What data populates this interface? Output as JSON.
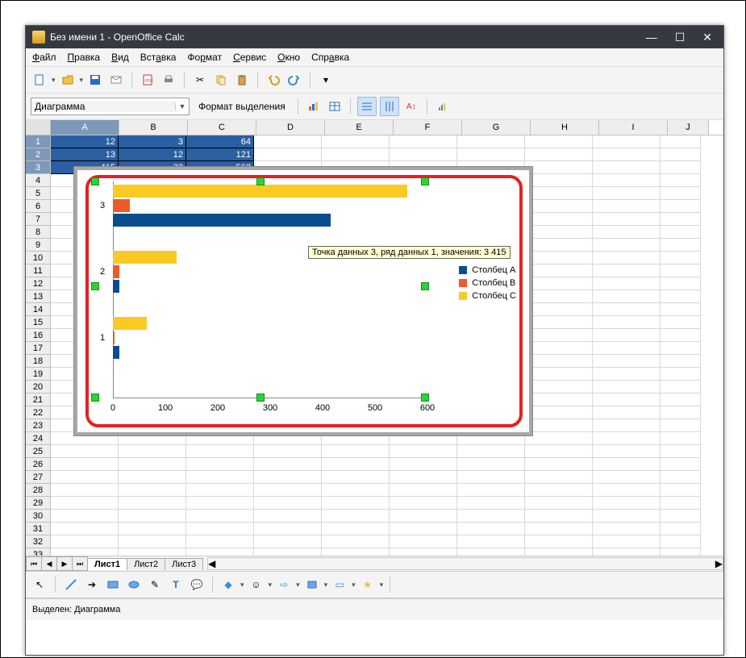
{
  "window": {
    "title": "Без имени 1 - OpenOffice Calc"
  },
  "menu": {
    "file": "Файл",
    "edit": "Правка",
    "view": "Вид",
    "insert": "Вставка",
    "format": "Формат",
    "tools": "Сервис",
    "window": "Окно",
    "help": "Справка"
  },
  "selection_box": {
    "value": "Диаграмма",
    "format_label": "Формат выделения"
  },
  "columns": [
    "A",
    "B",
    "C",
    "D",
    "E",
    "F",
    "G",
    "H",
    "I",
    "J"
  ],
  "row_count": 33,
  "data_cells": {
    "r1": {
      "A": "12",
      "B": "3",
      "C": "64"
    },
    "r2": {
      "A": "13",
      "B": "12",
      "C": "121"
    },
    "r3": {
      "A": "415",
      "B": "32",
      "C": "562"
    }
  },
  "legend": {
    "a": "Столбец A",
    "b": "Столбец B",
    "c": "Столбец C"
  },
  "x_ticks": [
    "0",
    "100",
    "200",
    "300",
    "400",
    "500",
    "600"
  ],
  "y_cats": [
    "1",
    "2",
    "3"
  ],
  "tooltip": "Точка данных 3, ряд данных 1, значения: 3 415",
  "tabs": {
    "t1": "Лист1",
    "t2": "Лист2",
    "t3": "Лист3"
  },
  "status": "Выделен: Диаграмма",
  "chart_data": {
    "type": "bar",
    "orientation": "horizontal",
    "categories": [
      "1",
      "2",
      "3"
    ],
    "series": [
      {
        "name": "Столбец A",
        "values": [
          12,
          13,
          415
        ],
        "color": "#0a4d8c"
      },
      {
        "name": "Столбец B",
        "values": [
          3,
          12,
          32
        ],
        "color": "#ef5a28"
      },
      {
        "name": "Столбец C",
        "values": [
          64,
          121,
          562
        ],
        "color": "#f9ca24"
      }
    ],
    "xlim": [
      0,
      600
    ],
    "xticks": [
      0,
      100,
      200,
      300,
      400,
      500,
      600
    ],
    "xlabel": "",
    "ylabel": "",
    "title": ""
  }
}
